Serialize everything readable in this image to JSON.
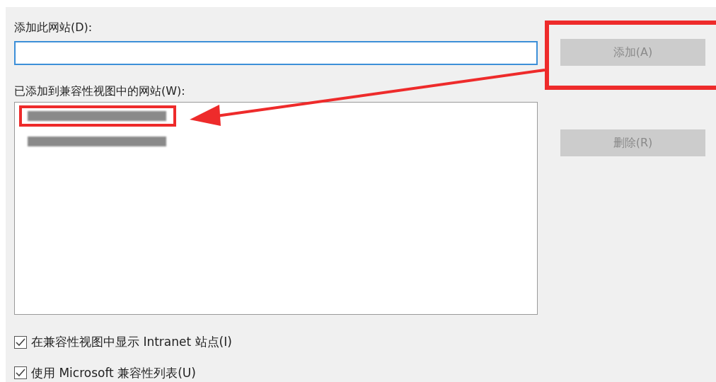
{
  "site_field": {
    "label": "添加此网站(D):"
  },
  "add_button": {
    "label": "添加(A)",
    "disabled": true,
    "highlighted": true
  },
  "sites_list": {
    "label": "已添加到兼容性视图中的网站(W):",
    "entries": [
      {
        "kind": "redacted",
        "highlighted": true
      },
      {
        "kind": "redacted",
        "highlighted": false
      }
    ]
  },
  "remove_button": {
    "label": "删除(R)",
    "disabled": true
  },
  "options": [
    {
      "label": "在兼容性视图中显示 Intranet 站点(I)",
      "checked": true
    },
    {
      "label": "使用 Microsoft 兼容性列表(U)",
      "checked": true
    }
  ]
}
